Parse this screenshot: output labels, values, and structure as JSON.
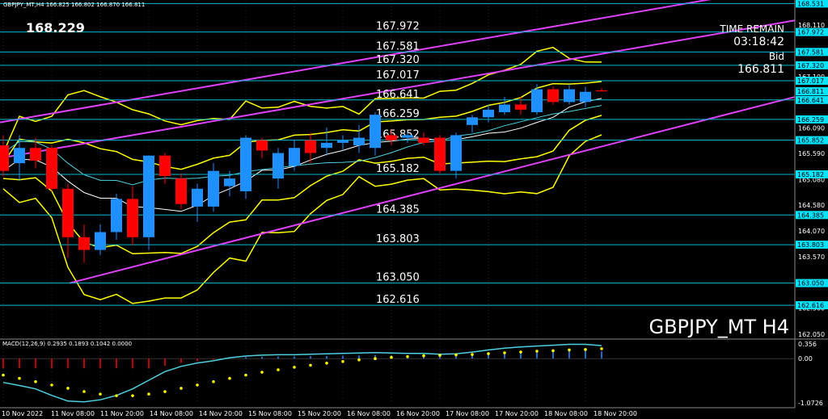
{
  "header": {
    "symbol_line": "GBPJPY_MT,H4  166.825 166.802 166.870 166.811",
    "big_price": "168.229",
    "time_remain_label": "TIME REMAIN",
    "time_remain_value": "03:18:42",
    "bid_label": "Bid",
    "bid_value": "166.811",
    "watermark": "GBPJPY_MT H4"
  },
  "macd": {
    "label": "MACD(12,26,9) 0.2935 0.1893 0.1042 0.0000",
    "axis_ticks": [
      "0.356",
      "0.00",
      "-1.0726"
    ]
  },
  "colors": {
    "background": "#000000",
    "bull": "#1e90ff",
    "bear": "#ff0000",
    "level_line": "#00bcd4",
    "channel": "#e040fb",
    "bands": "#ffff00",
    "ma_white": "#ffffff",
    "ma_aqua": "#4dd0e1",
    "axis_box": "#00e5ff"
  },
  "chart_data": {
    "type": "candlestick",
    "price_range": [
      162.0,
      168.6
    ],
    "levels": [
      167.972,
      167.581,
      167.32,
      167.017,
      166.641,
      166.259,
      165.852,
      165.182,
      164.385,
      163.803,
      163.05,
      162.616
    ],
    "level_labels": [
      "167.972",
      "167.581",
      "167.320",
      "167.017",
      "166.641",
      "166.259",
      "165.852",
      "165.182",
      "164.385",
      "163.803",
      "163.050",
      "162.616"
    ],
    "axis_boxes": [
      "168.531",
      "167.972",
      "167.581",
      "167.320",
      "167.017",
      "166.811",
      "166.641",
      "166.259",
      "165.852",
      "165.182",
      "164.385",
      "163.803",
      "163.050",
      "162.616"
    ],
    "axis_ticks": [
      "168.110",
      "167.100",
      "166.090",
      "165.590",
      "165.080",
      "164.580",
      "164.070",
      "163.570",
      "163.060",
      "162.560",
      "162.050"
    ],
    "date_labels": [
      "10 Nov 2022",
      "11 Nov 08:00",
      "11 Nov 20:00",
      "14 Nov 08:00",
      "14 Nov 20:00",
      "15 Nov 08:00",
      "15 Nov 20:00",
      "16 Nov 08:00",
      "16 Nov 20:00",
      "17 Nov 08:00",
      "17 Nov 20:00",
      "18 Nov 08:00",
      "18 Nov 20:00"
    ],
    "candles": [
      {
        "o": 165.75,
        "h": 165.95,
        "l": 165.15,
        "c": 165.25
      },
      {
        "o": 165.4,
        "h": 165.95,
        "l": 165.05,
        "c": 165.7
      },
      {
        "o": 165.7,
        "h": 165.9,
        "l": 165.3,
        "c": 165.45
      },
      {
        "o": 165.7,
        "h": 165.75,
        "l": 164.85,
        "c": 164.9
      },
      {
        "o": 164.9,
        "h": 165.0,
        "l": 163.55,
        "c": 163.95
      },
      {
        "o": 163.95,
        "h": 164.2,
        "l": 163.45,
        "c": 163.7
      },
      {
        "o": 163.7,
        "h": 164.2,
        "l": 163.6,
        "c": 164.05
      },
      {
        "o": 164.05,
        "h": 164.8,
        "l": 163.9,
        "c": 164.7
      },
      {
        "o": 164.7,
        "h": 164.95,
        "l": 163.8,
        "c": 163.95
      },
      {
        "o": 163.95,
        "h": 165.55,
        "l": 163.7,
        "c": 165.55
      },
      {
        "o": 165.55,
        "h": 165.6,
        "l": 165.0,
        "c": 165.15
      },
      {
        "o": 165.1,
        "h": 165.2,
        "l": 164.5,
        "c": 164.6
      },
      {
        "o": 164.55,
        "h": 165.0,
        "l": 164.25,
        "c": 164.9
      },
      {
        "o": 164.55,
        "h": 165.4,
        "l": 164.45,
        "c": 165.25
      },
      {
        "o": 164.95,
        "h": 165.25,
        "l": 164.75,
        "c": 165.1
      },
      {
        "o": 164.85,
        "h": 165.95,
        "l": 164.7,
        "c": 165.9
      },
      {
        "o": 165.85,
        "h": 165.9,
        "l": 165.5,
        "c": 165.65
      },
      {
        "o": 165.1,
        "h": 165.7,
        "l": 164.9,
        "c": 165.6
      },
      {
        "o": 165.35,
        "h": 165.85,
        "l": 165.25,
        "c": 165.7
      },
      {
        "o": 165.85,
        "h": 166.0,
        "l": 165.4,
        "c": 165.6
      },
      {
        "o": 165.7,
        "h": 166.1,
        "l": 165.55,
        "c": 165.8
      },
      {
        "o": 165.8,
        "h": 165.95,
        "l": 165.65,
        "c": 165.85
      },
      {
        "o": 165.75,
        "h": 166.15,
        "l": 165.6,
        "c": 165.9
      },
      {
        "o": 165.7,
        "h": 166.4,
        "l": 165.55,
        "c": 166.35
      },
      {
        "o": 165.95,
        "h": 166.05,
        "l": 165.75,
        "c": 165.85
      },
      {
        "o": 165.9,
        "h": 166.0,
        "l": 165.8,
        "c": 165.95
      },
      {
        "o": 165.9,
        "h": 166.0,
        "l": 165.75,
        "c": 165.8
      },
      {
        "o": 165.9,
        "h": 165.95,
        "l": 165.2,
        "c": 165.25
      },
      {
        "o": 165.25,
        "h": 166.0,
        "l": 165.1,
        "c": 165.95
      },
      {
        "o": 166.15,
        "h": 166.35,
        "l": 166.0,
        "c": 166.3
      },
      {
        "o": 166.3,
        "h": 166.55,
        "l": 166.2,
        "c": 166.45
      },
      {
        "o": 166.4,
        "h": 166.7,
        "l": 166.35,
        "c": 166.55
      },
      {
        "o": 166.55,
        "h": 166.7,
        "l": 166.35,
        "c": 166.45
      },
      {
        "o": 166.4,
        "h": 166.95,
        "l": 166.35,
        "c": 166.85
      },
      {
        "o": 166.85,
        "h": 166.9,
        "l": 166.55,
        "c": 166.6
      },
      {
        "o": 166.6,
        "h": 166.95,
        "l": 166.55,
        "c": 166.85
      },
      {
        "o": 166.6,
        "h": 166.9,
        "l": 166.5,
        "c": 166.8
      },
      {
        "o": 166.83,
        "h": 166.87,
        "l": 166.8,
        "c": 166.81
      }
    ],
    "macd_hist": [
      -0.55,
      -0.62,
      -0.7,
      -0.85,
      -0.98,
      -1.0,
      -0.95,
      -0.85,
      -0.7,
      -0.5,
      -0.3,
      -0.18,
      -0.1,
      -0.05,
      0.02,
      0.06,
      0.08,
      0.09,
      0.09,
      0.1,
      0.11,
      0.12,
      0.13,
      0.14,
      0.13,
      0.12,
      0.12,
      0.1,
      0.11,
      0.15,
      0.2,
      0.24,
      0.27,
      0.29,
      0.31,
      0.33,
      0.33,
      0.3
    ],
    "macd_signal": [
      -0.4,
      -0.48,
      -0.56,
      -0.64,
      -0.72,
      -0.8,
      -0.86,
      -0.9,
      -0.9,
      -0.86,
      -0.8,
      -0.72,
      -0.64,
      -0.56,
      -0.48,
      -0.4,
      -0.33,
      -0.27,
      -0.21,
      -0.16,
      -0.11,
      -0.07,
      -0.03,
      0.0,
      0.03,
      0.05,
      0.07,
      0.08,
      0.09,
      0.1,
      0.12,
      0.14,
      0.16,
      0.18,
      0.19,
      0.21,
      0.22,
      0.24
    ]
  }
}
